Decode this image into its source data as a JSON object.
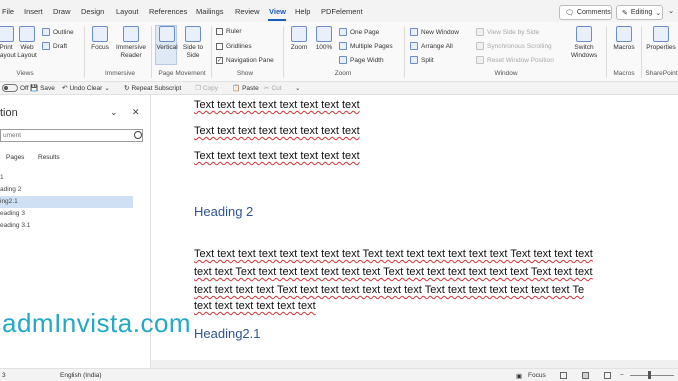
{
  "menu": {
    "tabs": [
      "File",
      "Insert",
      "Draw",
      "Design",
      "Layout",
      "References",
      "Mailings",
      "Review",
      "View",
      "Help",
      "PDFelement"
    ],
    "active_tab": "View",
    "comments_label": "Comments",
    "editing_label": "Editing"
  },
  "ribbon": {
    "views": {
      "print_layout": "Print Layout",
      "web_layout": "Web Layout",
      "outline": "Outline",
      "draft": "Draft",
      "group": "Views"
    },
    "immersive": {
      "focus": "Focus",
      "immersive_reader": "Immersive Reader",
      "group": "Immersive"
    },
    "page_movement": {
      "vertical": "Vertical",
      "side_to_side": "Side to Side",
      "group": "Page Movement"
    },
    "show": {
      "ruler": "Ruler",
      "gridlines": "Gridlines",
      "navigation_pane": "Navigation Pane",
      "navigation_checked": true,
      "group": "Show"
    },
    "zoom": {
      "zoom": "Zoom",
      "hundred": "100%",
      "one_page": "One Page",
      "multiple_pages": "Multiple Pages",
      "page_width": "Page Width",
      "group": "Zoom"
    },
    "window": {
      "new_window": "New Window",
      "arrange_all": "Arrange All",
      "split": "Split",
      "view_side_by_side": "View Side by Side",
      "synchronous_scrolling": "Synchronous Scrolling",
      "reset_window_position": "Reset Window Position",
      "switch_windows": "Switch Windows",
      "group": "Window"
    },
    "macros": {
      "label": "Macros",
      "group": "Macros"
    },
    "sharepoint": {
      "label": "Properties",
      "group": "SharePoint"
    }
  },
  "qat": {
    "autosave": "Off",
    "save": "Save",
    "undo": "Undo Clear",
    "repeat": "Repeat Subscript",
    "copy": "Copy",
    "paste": "Paste",
    "cut": "Cut"
  },
  "navigation": {
    "title": "tion",
    "search_placeholder": "ument",
    "tabs": [
      "Pages",
      "Results"
    ],
    "items": [
      "1",
      "ading 2",
      "ing2.1",
      "eading 3",
      "eading 3.1"
    ],
    "selected_index": 2
  },
  "document": {
    "lines": [
      "Text text  text text text text text text",
      "Text text  text text text text text text",
      "Text text  text text text text text text"
    ],
    "heading2": "Heading 2",
    "para": [
      "Text text  text text text text text text Text text  text text text text text Text text  text text",
      "text text Text text  text text text text text Text text  text text text text text  Text text  text",
      "text text text text Text text  text text text text text Text text  text text text text text  Te",
      "text text text text text text"
    ],
    "heading21": "Heading2.1"
  },
  "status": {
    "page": "3",
    "language": "English (India)",
    "focus": "Focus"
  },
  "watermark": "admInvista.com"
}
